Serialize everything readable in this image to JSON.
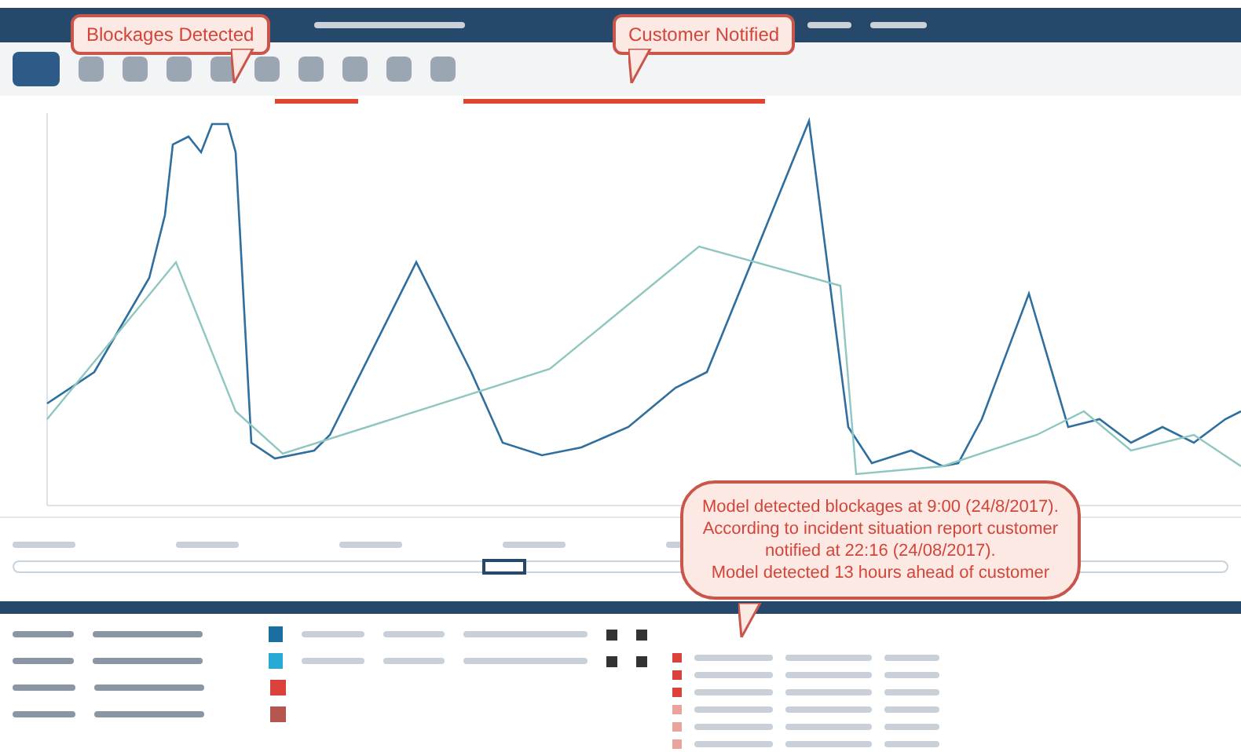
{
  "callouts": [
    {
      "kind": "small",
      "text": "Blockages Detected"
    },
    {
      "kind": "small",
      "text": "Customer Notified"
    },
    {
      "kind": "large",
      "lines": [
        "Model detected blockages at 9:00 (24/8/2017).",
        "According to incident situation report customer",
        "notified at 22:16 (24/08/2017).",
        "Model detected 13 hours ahead of customer"
      ]
    }
  ],
  "series": [
    {
      "color": "#1a6fa0",
      "controls": true
    },
    {
      "color": "#27a9d6",
      "controls": true
    },
    {
      "color": "#d9413a",
      "controls": false
    },
    {
      "color": "#b5574f",
      "controls": false
    }
  ],
  "events": [
    {
      "kind": "red"
    },
    {
      "kind": "red"
    },
    {
      "kind": "red"
    },
    {
      "kind": "pale"
    },
    {
      "kind": "pale"
    },
    {
      "kind": "pale"
    }
  ]
}
